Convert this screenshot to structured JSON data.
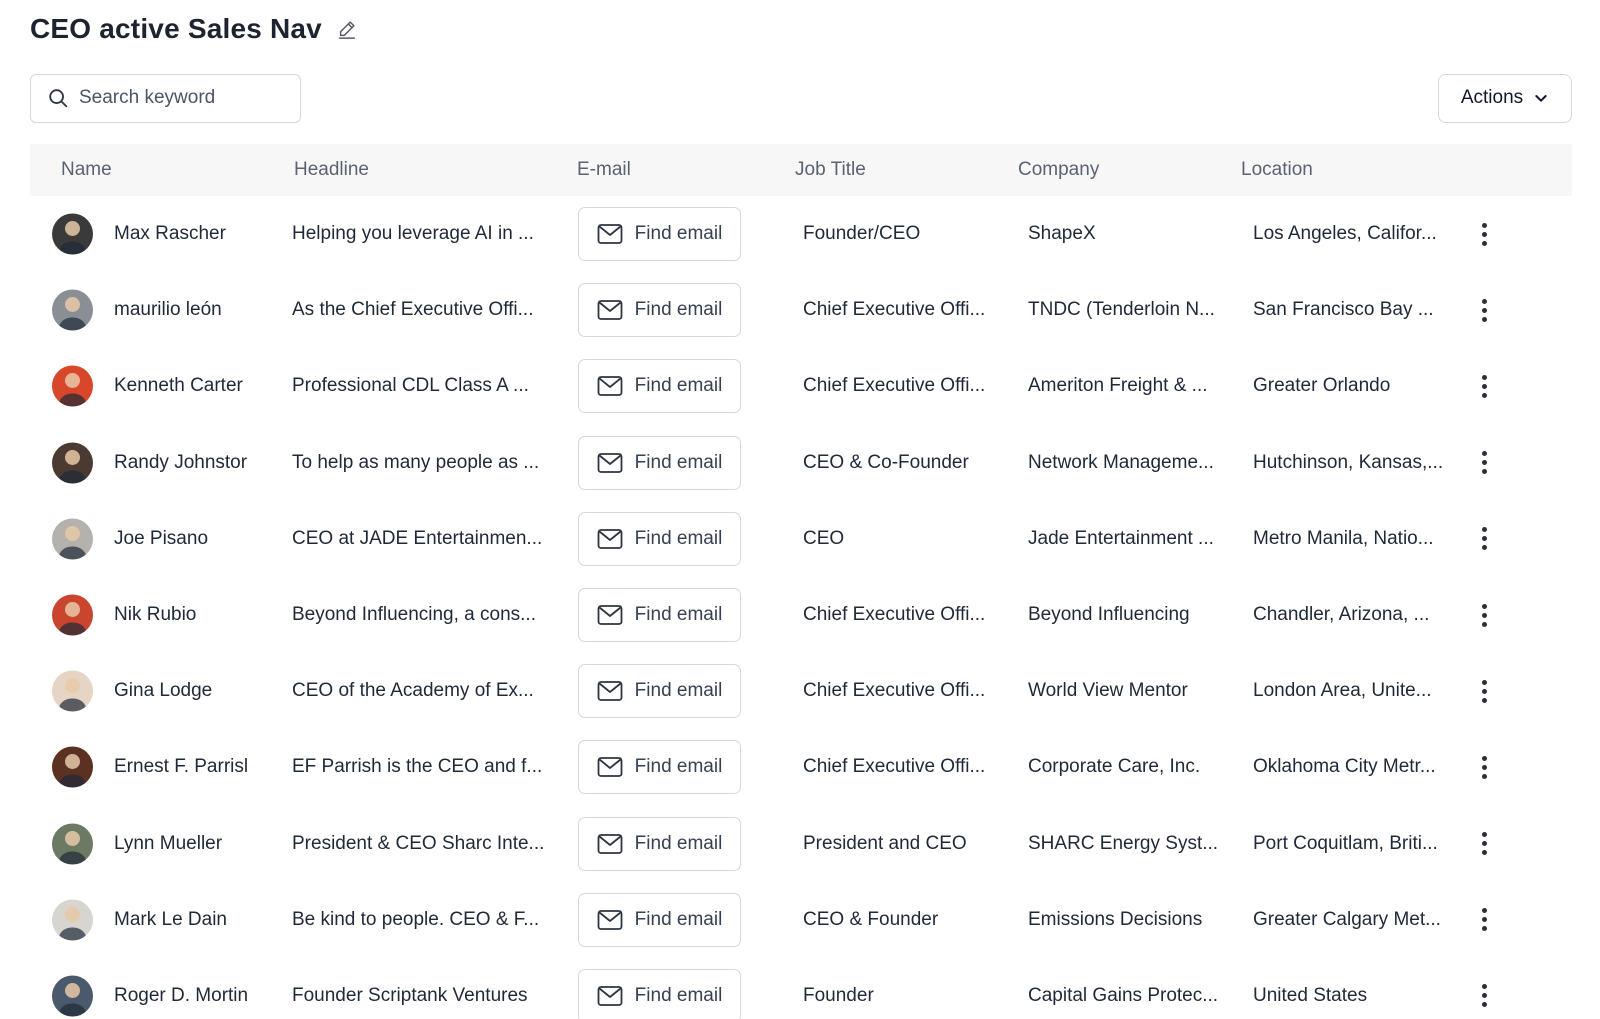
{
  "header": {
    "title": "CEO active Sales Nav",
    "edit_icon": "pencil-icon"
  },
  "search": {
    "placeholder": "Search keyword",
    "value": "",
    "icon": "search-icon"
  },
  "actions": {
    "label": "Actions",
    "icon": "chevron-down-icon"
  },
  "table": {
    "columns": {
      "name": "Name",
      "headline": "Headline",
      "email": "E-mail",
      "job_title": "Job Title",
      "company": "Company",
      "location": "Location"
    },
    "email_button_label": "Find email",
    "email_icon": "mail-icon",
    "row_menu_icon": "more-vertical-icon",
    "rows": [
      {
        "name": "Max Rascher",
        "headline": "Helping you leverage AI in ...",
        "job_title": "Founder/CEO",
        "company": "ShapeX",
        "location": "Los Angeles, Califor...",
        "avatar_color": "#3a3a3a"
      },
      {
        "name": "maurilio león",
        "headline": "As the Chief Executive Offi...",
        "job_title": "Chief Executive Offi...",
        "company": "TNDC (Tenderloin N...",
        "location": "San Francisco Bay ...",
        "avatar_color": "#8a8f96"
      },
      {
        "name": "Kenneth Carter",
        "headline": "Professional CDL Class A ...",
        "job_title": "Chief Executive Offi...",
        "company": "Ameriton Freight & ...",
        "location": "Greater Orlando",
        "avatar_color": "#d9472b"
      },
      {
        "name": "Randy Johnstor",
        "headline": "To help as many people as ...",
        "job_title": "CEO & Co-Founder",
        "company": "Network Manageme...",
        "location": "Hutchinson, Kansas,...",
        "avatar_color": "#4a3a32"
      },
      {
        "name": "Joe Pisano",
        "headline": "CEO at JADE Entertainmen...",
        "job_title": "CEO",
        "company": "Jade Entertainment ...",
        "location": "Metro Manila, Natio...",
        "avatar_color": "#b5b2ad"
      },
      {
        "name": "Nik Rubio",
        "headline": "Beyond Influencing, a cons...",
        "job_title": "Chief Executive Offi...",
        "company": "Beyond Influencing",
        "location": "Chandler, Arizona, ...",
        "avatar_color": "#c9452e"
      },
      {
        "name": "Gina Lodge",
        "headline": "CEO of the Academy of Ex...",
        "job_title": "Chief Executive Offi...",
        "company": "World View Mentor",
        "location": "London Area, Unite...",
        "avatar_color": "#e6d4c4"
      },
      {
        "name": "Ernest F. Parrisl",
        "headline": "EF Parrish is the CEO and f...",
        "job_title": "Chief Executive Offi...",
        "company": "Corporate Care, Inc.",
        "location": "Oklahoma City Metr...",
        "avatar_color": "#5b3122"
      },
      {
        "name": "Lynn Mueller",
        "headline": "President & CEO Sharc Inte...",
        "job_title": "President and CEO",
        "company": "SHARC Energy Syst...",
        "location": "Port Coquitlam, Briti...",
        "avatar_color": "#6c7a64"
      },
      {
        "name": "Mark Le Dain",
        "headline": "Be kind to people. CEO & F...",
        "job_title": "CEO & Founder",
        "company": "Emissions Decisions",
        "location": "Greater Calgary Met...",
        "avatar_color": "#d8d5d0"
      },
      {
        "name": "Roger D. Mortin",
        "headline": "Founder Scriptank Ventures",
        "job_title": "Founder",
        "company": "Capital Gains Protec...",
        "location": "United States",
        "avatar_color": "#4a5a6c"
      }
    ]
  }
}
